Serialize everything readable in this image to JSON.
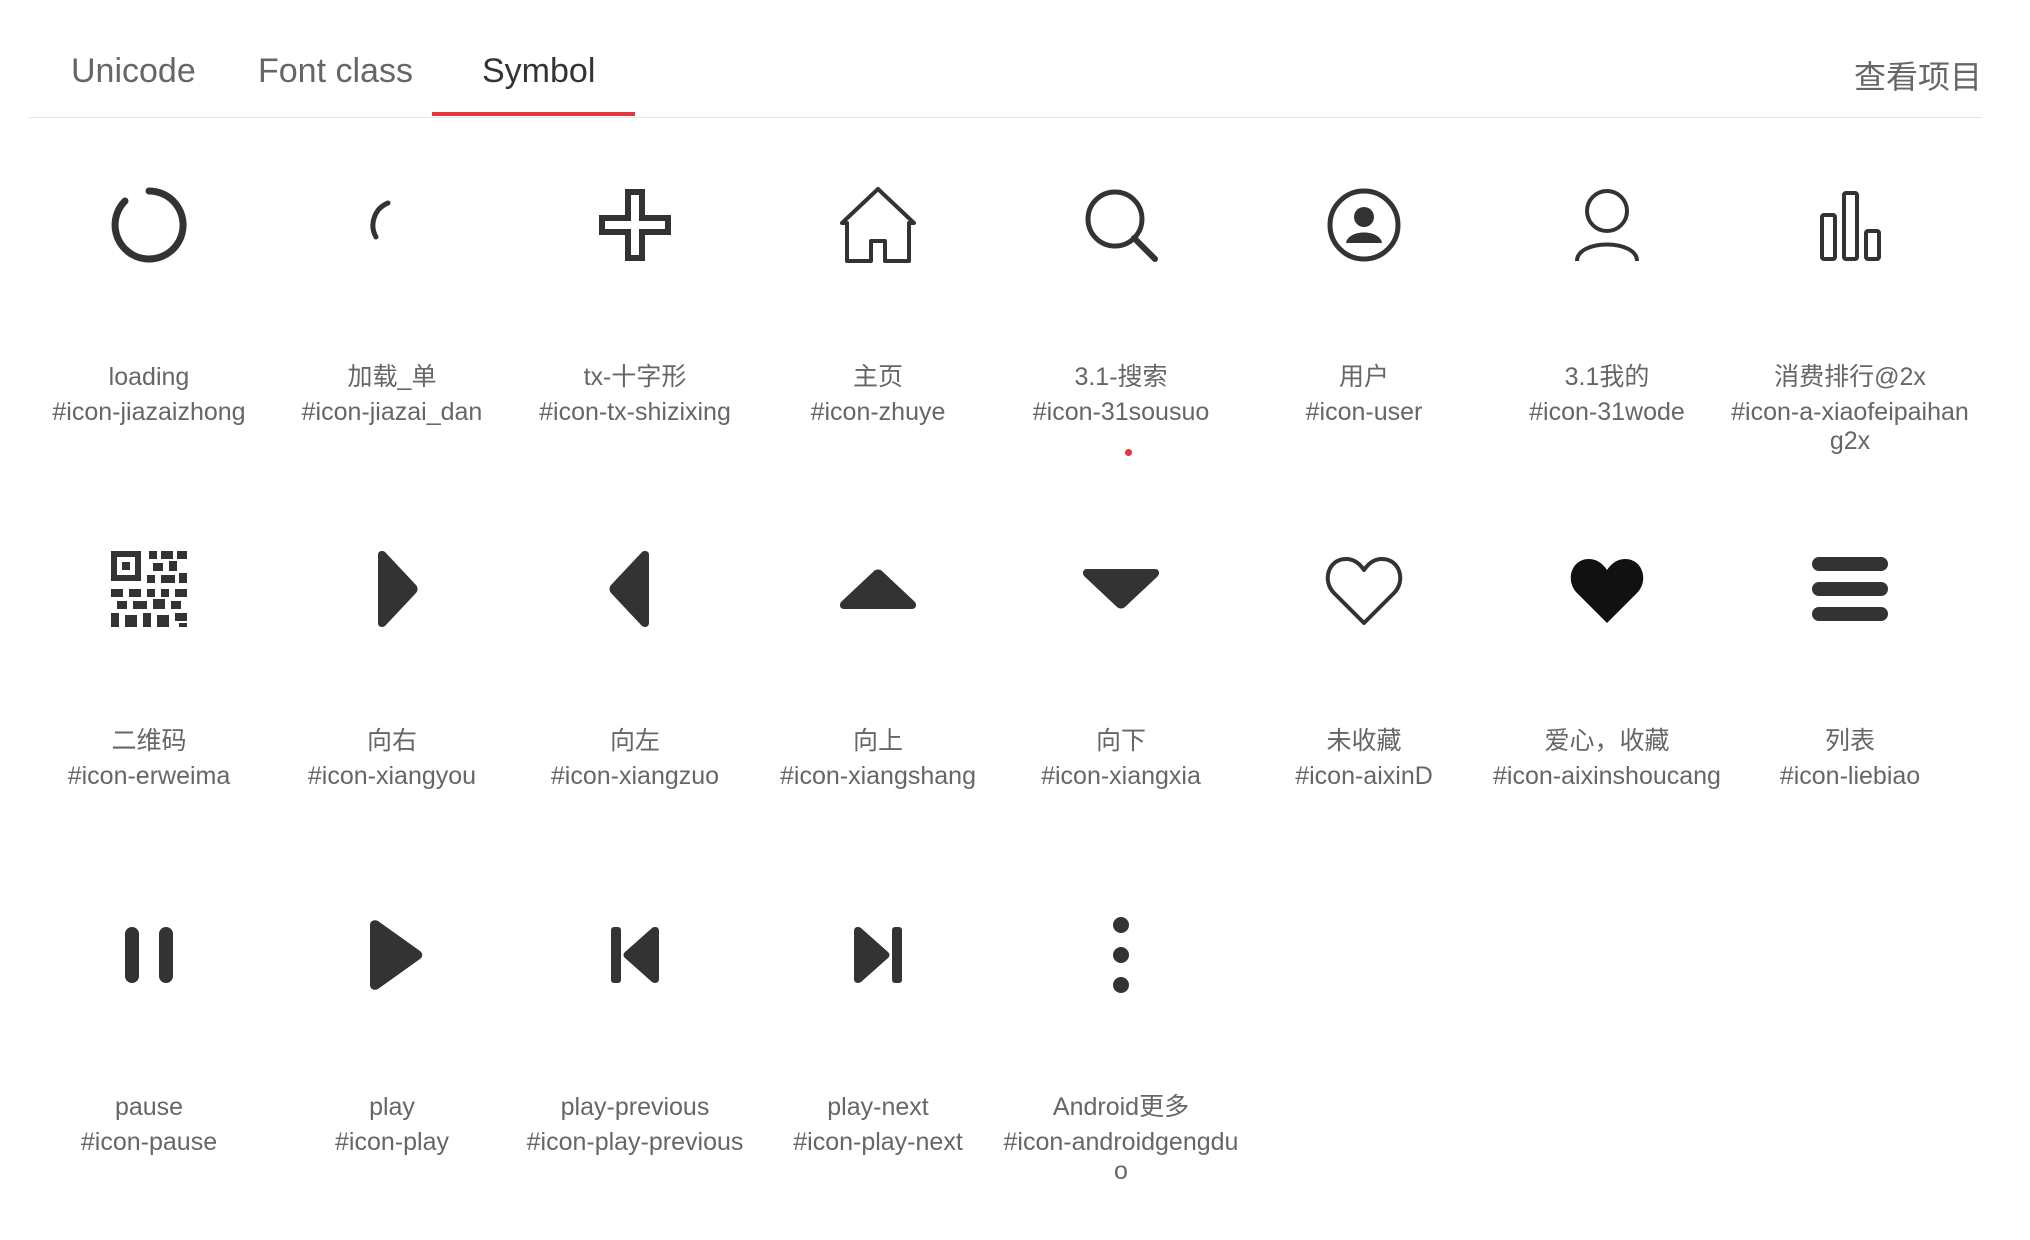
{
  "tabs": [
    {
      "label": "Unicode"
    },
    {
      "label": "Font class"
    },
    {
      "label": "Symbol"
    }
  ],
  "active_tab": "Symbol",
  "view_project_label": "查看项目",
  "accent_color": "#e4393c",
  "icons": [
    {
      "name": "loading",
      "code": "#icon-jiazaizhong",
      "icon": "loading-icon"
    },
    {
      "name": "加载_单",
      "code": "#icon-jiazai_dan",
      "icon": "loading-single-icon"
    },
    {
      "name": "tx-十字形",
      "code": "#icon-tx-shizixing",
      "icon": "cross-icon"
    },
    {
      "name": "主页",
      "code": "#icon-zhuye",
      "icon": "home-icon"
    },
    {
      "name": "3.1-搜索",
      "code": "#icon-31sousuo",
      "icon": "search-icon"
    },
    {
      "name": "用户",
      "code": "#icon-user",
      "icon": "user-circle-icon"
    },
    {
      "name": "3.1我的",
      "code": "#icon-31wode",
      "icon": "user-icon"
    },
    {
      "name": "消费排行@2x",
      "code": "#icon-a-xiaofeipaihang2x",
      "icon": "bar-chart-icon"
    },
    {
      "name": "二维码",
      "code": "#icon-erweima",
      "icon": "qrcode-icon"
    },
    {
      "name": "向右",
      "code": "#icon-xiangyou",
      "icon": "arrow-right-icon"
    },
    {
      "name": "向左",
      "code": "#icon-xiangzuo",
      "icon": "arrow-left-icon"
    },
    {
      "name": "向上",
      "code": "#icon-xiangshang",
      "icon": "arrow-up-icon"
    },
    {
      "name": "向下",
      "code": "#icon-xiangxia",
      "icon": "arrow-down-icon"
    },
    {
      "name": "未收藏",
      "code": "#icon-aixinD",
      "icon": "heart-outline-icon"
    },
    {
      "name": "爱心，收藏",
      "code": "#icon-aixinshoucang",
      "icon": "heart-filled-icon"
    },
    {
      "name": "列表",
      "code": "#icon-liebiao",
      "icon": "list-icon"
    },
    {
      "name": "pause",
      "code": "#icon-pause",
      "icon": "pause-icon"
    },
    {
      "name": "play",
      "code": "#icon-play",
      "icon": "play-icon"
    },
    {
      "name": "play-previous",
      "code": "#icon-play-previous",
      "icon": "play-previous-icon"
    },
    {
      "name": "play-next",
      "code": "#icon-play-next",
      "icon": "play-next-icon"
    },
    {
      "name": "Android更多",
      "code": "#icon-androidgengduo",
      "icon": "more-vertical-icon"
    }
  ]
}
